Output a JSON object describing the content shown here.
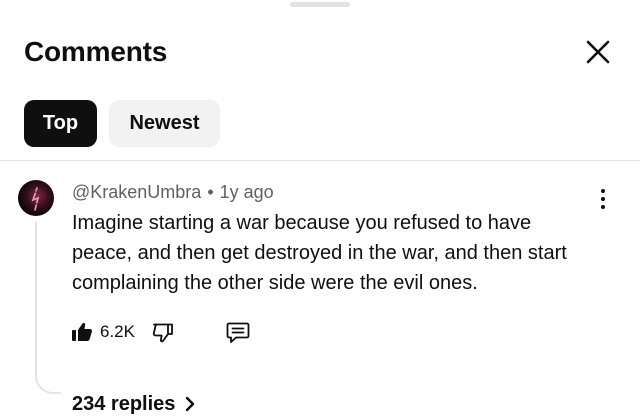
{
  "sheet": {
    "title": "Comments"
  },
  "tabs": [
    {
      "label": "Top",
      "active": true
    },
    {
      "label": "Newest",
      "active": false
    }
  ],
  "comment": {
    "author": "@KrakenUmbra",
    "separator": "•",
    "time": "1y ago",
    "text": "Imagine starting a war because you refused to have peace, and then get destroyed in the war, and then start complaining the other side were the evil ones.",
    "likes": "6.2K",
    "replies": "234 replies"
  },
  "icons": {
    "close": "close-icon",
    "more": "more-vert-icon",
    "like": "thumbs-up-filled-icon",
    "dislike": "thumbs-down-outline-icon",
    "reply": "reply-comment-icon",
    "chevron": "chevron-right-icon"
  },
  "colors": {
    "active_chip_bg": "#0f0f0f",
    "inactive_chip_bg": "#f2f2f2",
    "meta_text": "#606060",
    "divider": "#e5e5e5"
  }
}
